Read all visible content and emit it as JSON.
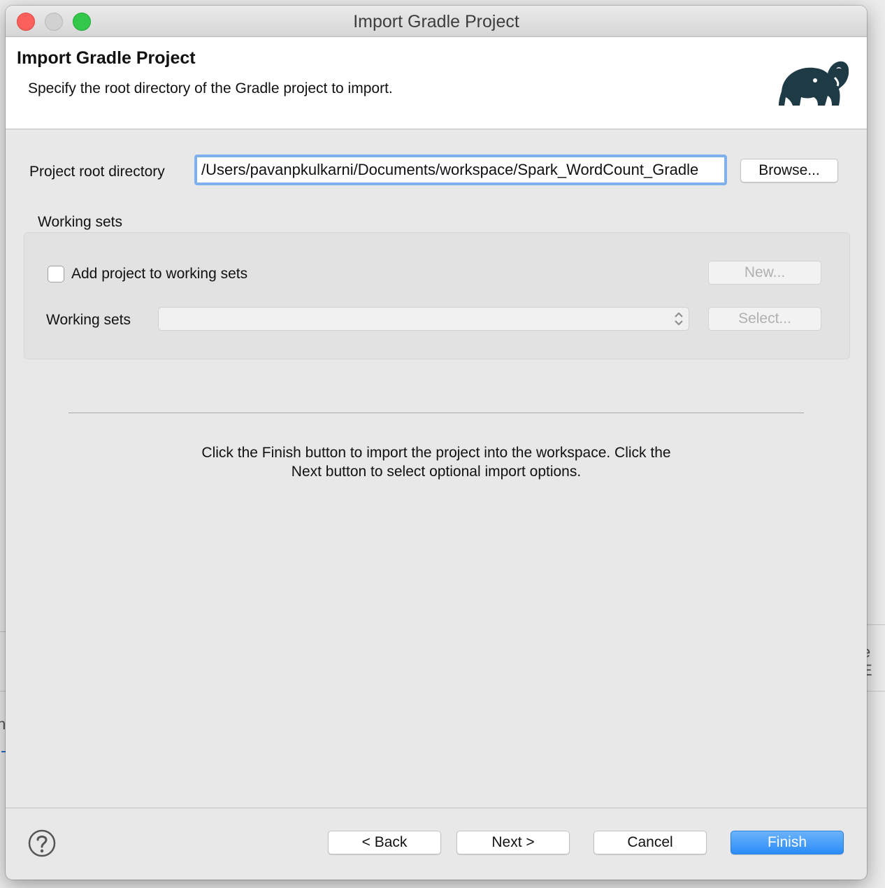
{
  "window": {
    "title": "Import Gradle Project"
  },
  "header": {
    "title": "Import Gradle Project",
    "description": "Specify the root directory of the Gradle project to import."
  },
  "project_root": {
    "label": "Project root directory",
    "value": "/Users/pavanpkulkarni/Documents/workspace/Spark_WordCount_Gradle",
    "browse_label": "Browse..."
  },
  "working_sets": {
    "group_label": "Working sets",
    "checkbox_label": "Add project to working sets",
    "new_label": "New...",
    "field_label": "Working sets",
    "select_label": "Select..."
  },
  "info": {
    "line1": "Click the Finish button to import the project into the workspace. Click the",
    "line2": "Next button to select optional import options."
  },
  "buttons": {
    "back": "< Back",
    "next": "Next >",
    "cancel": "Cancel",
    "finish": "Finish"
  },
  "background": {
    "fragment_1": "e E",
    "fragment_2": "n"
  },
  "colors": {
    "accent": "#2a8cf7",
    "focus_ring": "#7fb0ee",
    "logo": "#1e3b45"
  },
  "icons": {
    "logo": "gradle-elephant-icon",
    "help": "help-icon",
    "combo": "updown-chevron-icon"
  }
}
